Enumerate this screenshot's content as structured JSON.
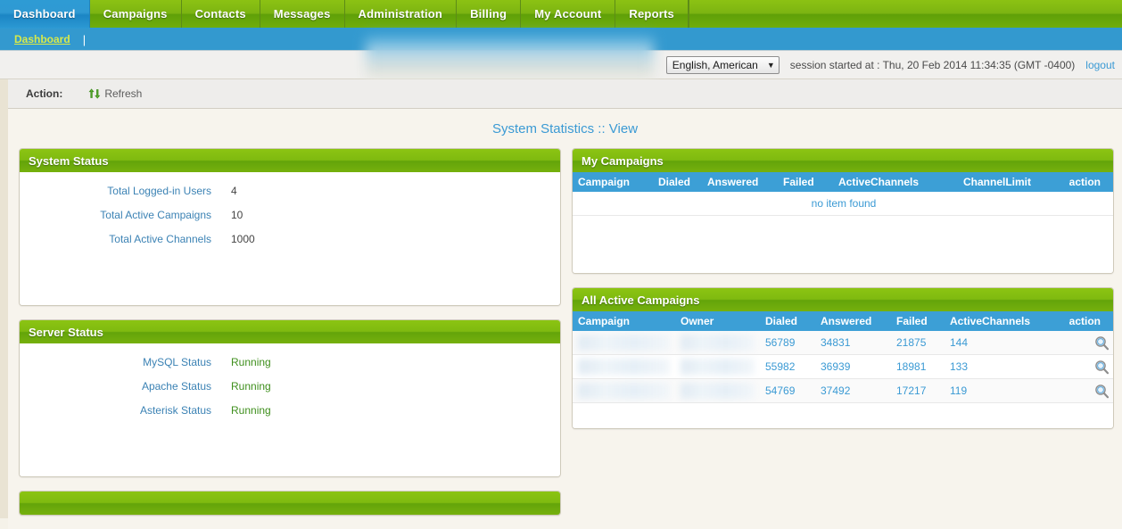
{
  "nav": {
    "tabs": [
      {
        "label": "Dashboard",
        "active": true
      },
      {
        "label": "Campaigns",
        "active": false
      },
      {
        "label": "Contacts",
        "active": false
      },
      {
        "label": "Messages",
        "active": false
      },
      {
        "label": "Administration",
        "active": false
      },
      {
        "label": "Billing",
        "active": false
      },
      {
        "label": "My Account",
        "active": false
      },
      {
        "label": "Reports",
        "active": false
      }
    ]
  },
  "breadcrumb": {
    "current": "Dashboard",
    "separator": "|"
  },
  "header": {
    "language": "English, American",
    "language_caret": "▼",
    "session": "session started at : Thu, 20 Feb 2014 11:34:35 (GMT -0400)",
    "logout": "logout"
  },
  "action_bar": {
    "label": "Action:",
    "refresh": "Refresh"
  },
  "page_title": "System Statistics :: View",
  "panels": {
    "system_status": {
      "title": "System Status",
      "rows": [
        {
          "label": "Total Logged-in Users",
          "value": "4"
        },
        {
          "label": "Total Active Campaigns",
          "value": "10"
        },
        {
          "label": "Total Active Channels",
          "value": "1000"
        }
      ]
    },
    "server_status": {
      "title": "Server Status",
      "rows": [
        {
          "label": "MySQL Status",
          "value": "Running"
        },
        {
          "label": "Apache Status",
          "value": "Running"
        },
        {
          "label": "Asterisk Status",
          "value": "Running"
        }
      ]
    },
    "my_campaigns": {
      "title": "My Campaigns",
      "columns": [
        "Campaign",
        "Dialed",
        "Answered",
        "Failed",
        "ActiveChannels",
        "ChannelLimit",
        "action"
      ],
      "rows": [],
      "empty_message": "no item found"
    },
    "all_active_campaigns": {
      "title": "All Active Campaigns",
      "columns": [
        "Campaign",
        "Owner",
        "Dialed",
        "Answered",
        "Failed",
        "ActiveChannels",
        "action"
      ],
      "rows": [
        {
          "campaign": "",
          "owner": "",
          "dialed": "56789",
          "answered": "34831",
          "failed": "21875",
          "active_channels": "144",
          "action_icon": "search-icon"
        },
        {
          "campaign": "",
          "owner": "",
          "dialed": "55982",
          "answered": "36939",
          "failed": "18981",
          "active_channels": "133",
          "action_icon": "search-icon"
        },
        {
          "campaign": "",
          "owner": "",
          "dialed": "54769",
          "answered": "37492",
          "failed": "17217",
          "active_channels": "119",
          "action_icon": "search-icon"
        }
      ]
    }
  },
  "colors": {
    "nav_green": "#7cb412",
    "active_blue": "#2e9bd4",
    "panel_header_green": "#7fba10",
    "table_header_blue": "#3c9fd6",
    "link_blue": "#3b9ad4",
    "label_blue": "#3b82b4",
    "status_green": "#3f8f1d",
    "page_bg": "#f7f4ed"
  }
}
